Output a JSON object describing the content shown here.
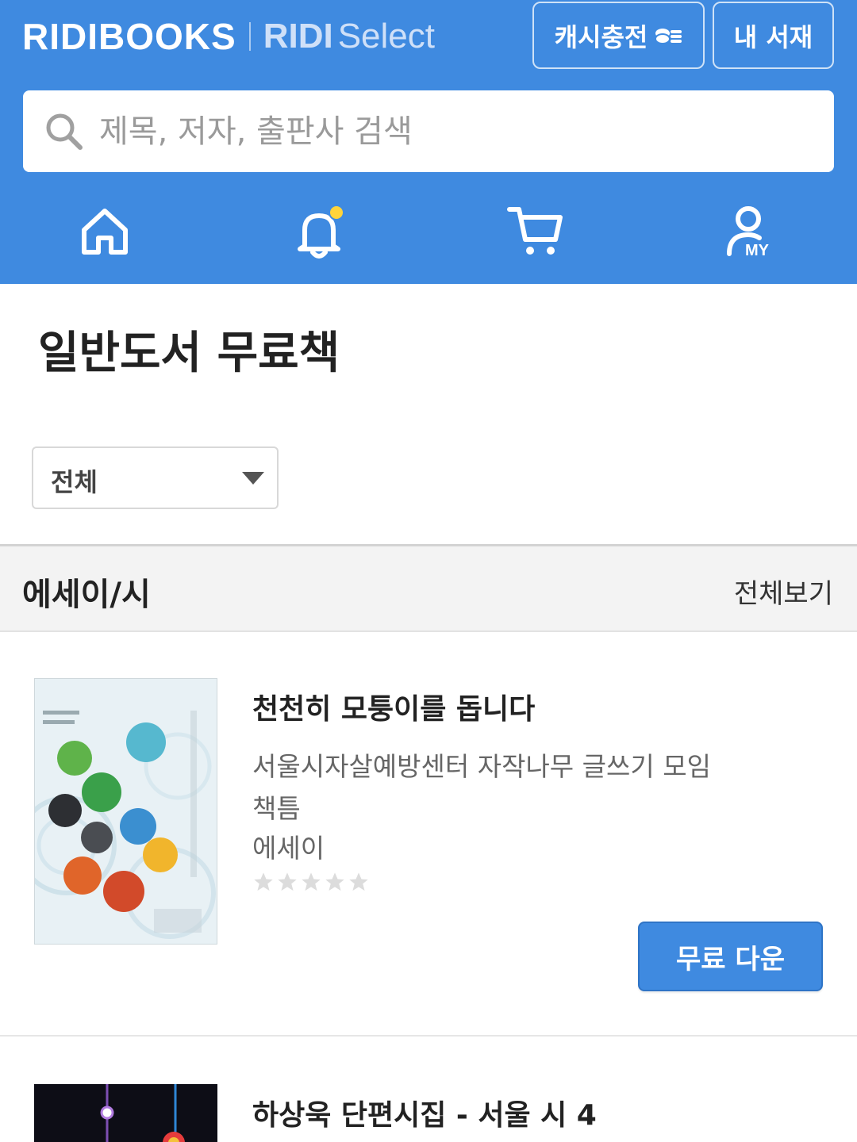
{
  "header": {
    "logo_main": "RIDIBOOKS",
    "logo_sub_bold": "RIDI",
    "logo_sub_light": "Select",
    "cash_button_label": "캐시충전",
    "library_button_label": "내 서재",
    "search": {
      "placeholder": "제목, 저자, 출판사 검색",
      "value": ""
    },
    "nav": [
      {
        "icon": "home-icon"
      },
      {
        "icon": "bell-icon",
        "badge_color": "#ffd43b"
      },
      {
        "icon": "cart-icon"
      },
      {
        "icon": "my-icon",
        "label": "MY"
      }
    ],
    "accent_color": "#3f8ae0"
  },
  "page": {
    "title": "일반도서 무료책",
    "filter": {
      "selected": "전체"
    }
  },
  "section": {
    "title": "에세이/시",
    "more_label": "전체보기"
  },
  "books": [
    {
      "title": "천천히 모퉁이를 돕니다",
      "author": "서울시자살예방센터 자작나무 글쓰기 모임",
      "publisher": "책틈",
      "category": "에세이",
      "rating_stars": 0,
      "download_label": "무료 다운"
    },
    {
      "title": "하상욱 단편시집 - 서울 시 4"
    }
  ]
}
